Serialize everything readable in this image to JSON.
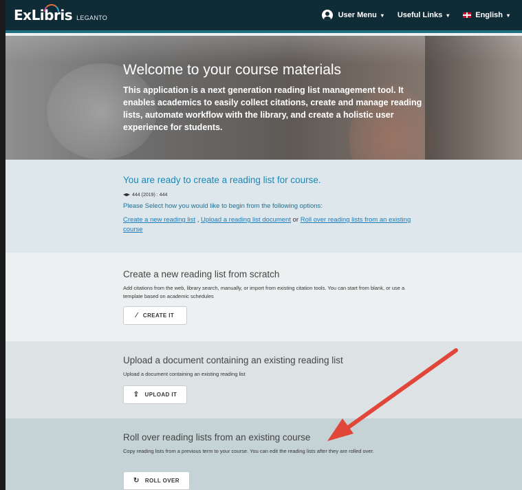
{
  "header": {
    "brand": "ExLibris",
    "product": "LEGANTO",
    "user_menu": "User Menu",
    "useful_links": "Useful Links",
    "language": "English"
  },
  "hero": {
    "title": "Welcome to your course materials",
    "text": "This application is a next generation reading list management tool. It enables academics to easily collect citations, create and manage reading lists, automate workflow with the library, and create a holistic user experience for students."
  },
  "ready": {
    "title": "You are ready to create a reading list for course.",
    "course": "444 (2019) : 444",
    "select_text": "Please Select how you would like to begin from the following options:",
    "link_create": "Create a new reading list",
    "sep1": " , ",
    "link_upload": "Upload a reading list document",
    "sep2": " or ",
    "link_roll": "Roll over reading lists from an existing course"
  },
  "create": {
    "title": "Create a new reading list from scratch",
    "desc": "Add citations from the web, library search, manually, or import from existing citation tools. You can start from blank, or use a template based on academic schedules",
    "button": "CREATE IT"
  },
  "upload": {
    "title": "Upload a document containing an existing reading list",
    "desc": "Upload a document containing an existing reading list",
    "button": "UPLOAD IT"
  },
  "roll": {
    "title": "Roll over reading lists from an existing course",
    "desc": "Copy reading lists from a previous term to your course. You can edit the reading lists after they are rolled over.",
    "button": "ROLL OVER"
  },
  "icons": {
    "user": "user-icon",
    "flag": "uk-flag-icon",
    "wand": "magic-wand-icon",
    "upload": "upload-icon",
    "rollover": "refresh-icon",
    "course": "graduation-cap-icon"
  },
  "colors": {
    "header_bg": "#0f2b36",
    "accent": "#1e6f80",
    "link": "#1b7ab8",
    "annotation_arrow": "#e0473a"
  }
}
